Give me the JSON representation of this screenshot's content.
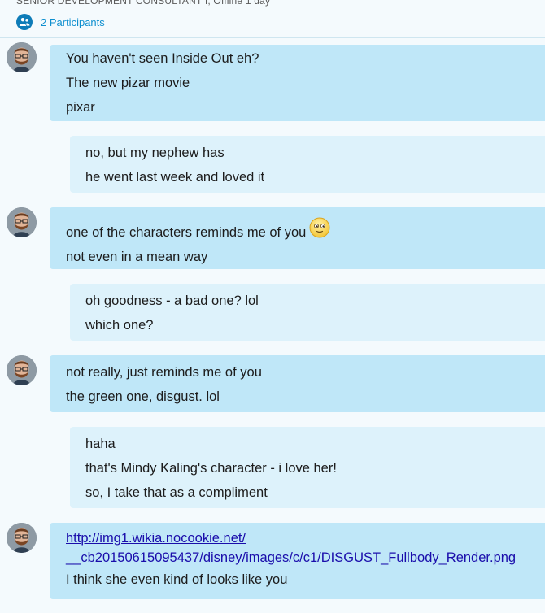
{
  "header": {
    "subtitle": "SENIOR DEVELOPMENT CONSULTANT I, Offline 1 day",
    "participants_label": "2 Participants"
  },
  "messages": [
    {
      "side": "in",
      "lines": [
        "You haven't seen Inside Out eh?",
        "The new pizar movie",
        "pixar"
      ]
    },
    {
      "side": "out",
      "lines": [
        "no, but my nephew has",
        "he went last week and loved it"
      ]
    },
    {
      "side": "in",
      "lines": [
        "one of the characters reminds me of you",
        "not even in a mean way"
      ],
      "emoji": "smiley-emoji"
    },
    {
      "side": "out",
      "lines": [
        "oh goodness - a bad one? lol",
        "which one?"
      ]
    },
    {
      "side": "in",
      "lines": [
        "not really, just reminds me of you",
        "the green one, disgust. lol"
      ]
    },
    {
      "side": "out",
      "lines": [
        "haha",
        "that's Mindy Kaling's character - i love her!",
        "so, I take that as a compliment"
      ]
    },
    {
      "side": "in",
      "link": [
        "http://img1.wikia.nocookie.net/",
        "__cb20150615095437/disney/images/c/c1/DISGUST_Fullbody_Render.png"
      ],
      "lines": [
        "I think she even kind of looks like you"
      ]
    }
  ],
  "colors": {
    "incoming_bubble": "#bfe7f8",
    "outgoing_bubble": "#ddf2fb",
    "background": "#f4fafd",
    "link": "#1a0dab",
    "accent": "#0e8fcf"
  }
}
